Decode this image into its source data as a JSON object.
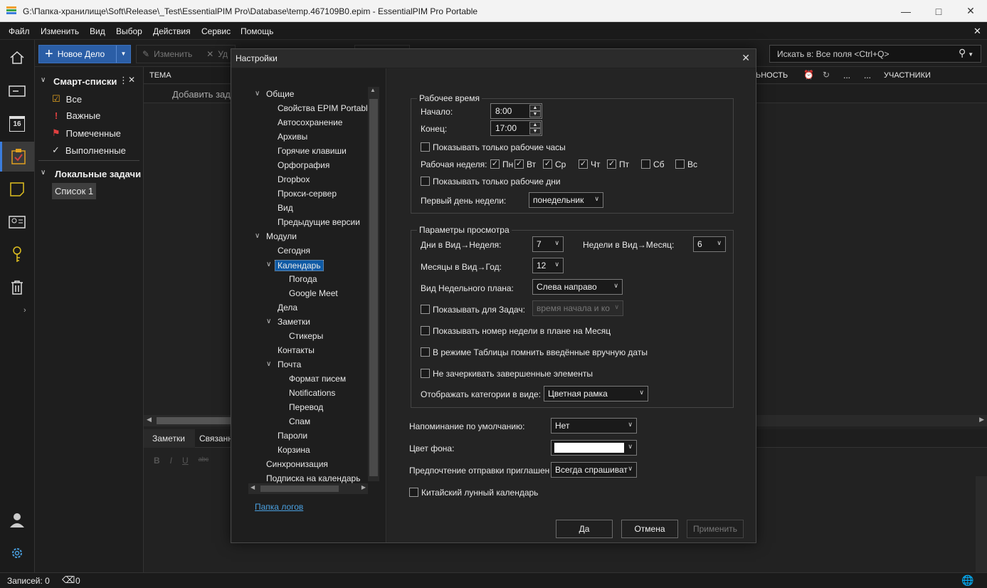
{
  "titlebar": {
    "title": "G:\\Папка-хранилище\\Soft\\Release\\_Test\\EssentialPIM Pro\\Database\\temp.467109B0.epim - EssentialPIM Pro Portable"
  },
  "menu": [
    "Файл",
    "Изменить",
    "Вид",
    "Выбор",
    "Действия",
    "Сервис",
    "Помощь"
  ],
  "toolbar": {
    "new_task": "Новое Дело",
    "edit": "Изменить",
    "delete": "Уд",
    "search_placeholder": "Искать в: Все поля  <Ctrl+Q>"
  },
  "calendar_day": "16",
  "smart": {
    "header": "Смарт-списки",
    "items": [
      "Все",
      "Важные",
      "Помеченные",
      "Выполненные"
    ],
    "local_header": "Локальные задачи",
    "list1": "Список 1"
  },
  "grid": {
    "col_subject": "ТЕМА",
    "col_priority": "ЬНОСТЬ",
    "col_more1": "...",
    "col_more2": "...",
    "col_participants": "УЧАСТНИКИ",
    "add_task": "Добавить зад"
  },
  "bottom": {
    "tab_notes": "Заметки",
    "tab_related": "Связанн"
  },
  "status": {
    "records": "Записей: 0",
    "notifications": "0"
  },
  "dialog": {
    "title": "Настройки",
    "tree": [
      {
        "label": "Общие",
        "level": 0,
        "expanded": true
      },
      {
        "label": "Свойства EPIM Portable",
        "level": 1
      },
      {
        "label": "Автосохранение",
        "level": 1
      },
      {
        "label": "Архивы",
        "level": 1
      },
      {
        "label": "Горячие клавиши",
        "level": 1
      },
      {
        "label": "Орфография",
        "level": 1
      },
      {
        "label": "Dropbox",
        "level": 1
      },
      {
        "label": "Прокси-сервер",
        "level": 1
      },
      {
        "label": "Вид",
        "level": 1
      },
      {
        "label": "Предыдущие версии",
        "level": 1
      },
      {
        "label": "Модули",
        "level": 0,
        "expanded": true
      },
      {
        "label": "Сегодня",
        "level": 1
      },
      {
        "label": "Календарь",
        "level": 1,
        "expanded": true,
        "selected": true
      },
      {
        "label": "Погода",
        "level": 2
      },
      {
        "label": "Google Meet",
        "level": 2
      },
      {
        "label": "Дела",
        "level": 1
      },
      {
        "label": "Заметки",
        "level": 1,
        "expanded": true
      },
      {
        "label": "Стикеры",
        "level": 2
      },
      {
        "label": "Контакты",
        "level": 1
      },
      {
        "label": "Почта",
        "level": 1,
        "expanded": true
      },
      {
        "label": "Формат писем",
        "level": 2
      },
      {
        "label": "Notifications",
        "level": 2
      },
      {
        "label": "Перевод",
        "level": 2
      },
      {
        "label": "Спам",
        "level": 2
      },
      {
        "label": "Пароли",
        "level": 1
      },
      {
        "label": "Корзина",
        "level": 1
      },
      {
        "label": "Синхронизация",
        "level": 0
      },
      {
        "label": "Подписка на календарь",
        "level": 0
      }
    ],
    "log_link": "Папка логов",
    "work": {
      "group": "Рабочее время",
      "start_label": "Начало:",
      "start": "8:00",
      "end_label": "Конец:",
      "end": "17:00",
      "only_work_hours": "Показывать только рабочие часы",
      "week_label": "Рабочая неделя:",
      "days": [
        {
          "d": "Пн",
          "on": true
        },
        {
          "d": "Вт",
          "on": true
        },
        {
          "d": "Ср",
          "on": true
        },
        {
          "d": "Чт",
          "on": true
        },
        {
          "d": "Пт",
          "on": true
        },
        {
          "d": "Сб",
          "on": false
        },
        {
          "d": "Вс",
          "on": false
        }
      ],
      "only_work_days": "Показывать только рабочие дни",
      "first_day_label": "Первый день недели:",
      "first_day": "понедельник"
    },
    "view": {
      "group": "Параметры просмотра",
      "days_week_label": "Дни в Вид→Неделя:",
      "days_week": "7",
      "weeks_month_label": "Недели в Вид→Месяц:",
      "weeks_month": "6",
      "months_year_label": "Месяцы в Вид→Год:",
      "months_year": "12",
      "week_plan_label": "Вид Недельного плана:",
      "week_plan": "Слева направо",
      "show_tasks_label": "Показывать для Задач:",
      "show_tasks": "время начала и ко",
      "week_number": "Показывать номер недели в плане на Месяц",
      "remember_dates": "В режиме Таблицы помнить введённые вручную даты",
      "no_strike": "Не зачеркивать завершенные элементы",
      "categories_label": "Отображать категории в виде:",
      "categories": "Цветная рамка"
    },
    "reminder_label": "Напоминание по умолчанию:",
    "reminder": "Нет",
    "bg_label": "Цвет фона:",
    "invite_label": "Предпочтение отправки приглашен",
    "invite": "Всегда спрашиват",
    "lunar": "Китайский лунный календарь",
    "ok": "Да",
    "cancel": "Отмена",
    "apply": "Применить"
  },
  "colors": {
    "accent": "#2b5ea6",
    "selection": "#0e5aa5"
  }
}
